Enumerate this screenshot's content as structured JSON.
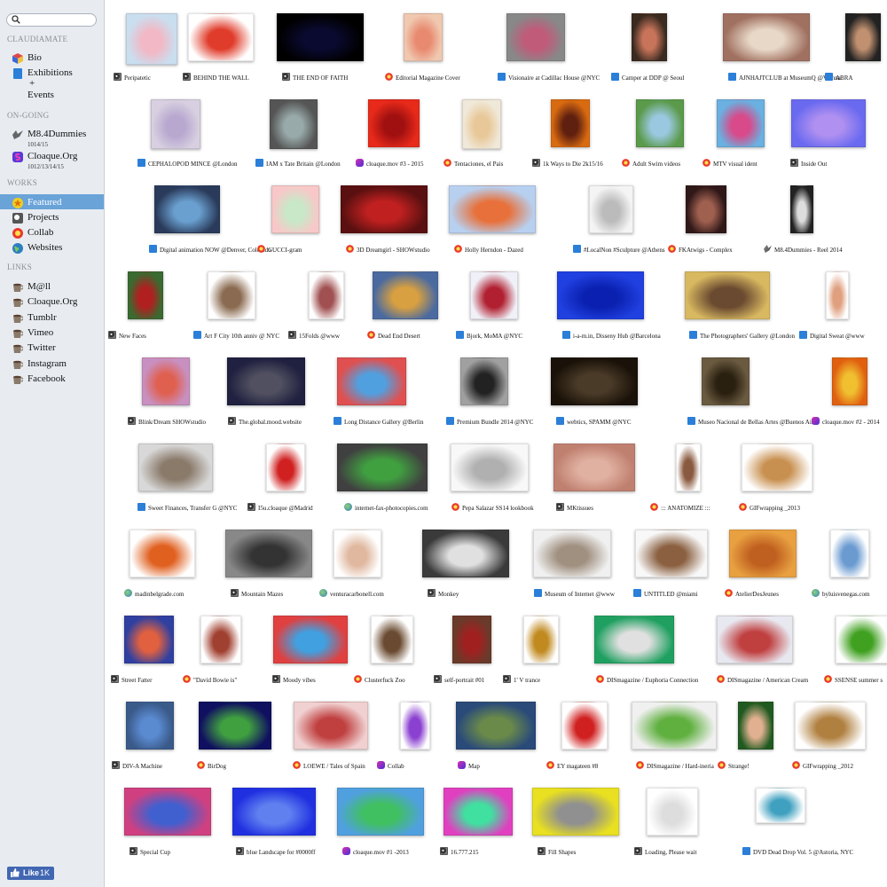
{
  "site": {
    "name": "CLAUDIAMATE",
    "search_placeholder": ""
  },
  "sidebar": {
    "top_items": [
      {
        "label": "Bio",
        "icon": "cube-icon"
      },
      {
        "label": "Exhibitions",
        "label2": "+",
        "label3": "Events",
        "icon": "document-icon"
      }
    ],
    "ongoing_title": "ON-GOING",
    "ongoing": [
      {
        "label": "M8.4Dummies",
        "sub": "1014/15",
        "icon": "bird-icon"
      },
      {
        "label": "Cloaque.Org",
        "sub": "1012/13/14/15",
        "icon": "cloaque-icon"
      }
    ],
    "works_title": "WORKS",
    "works": [
      {
        "label": "Featured",
        "icon": "star-icon",
        "active": true
      },
      {
        "label": "Projects",
        "icon": "work-icon"
      },
      {
        "label": "Collab",
        "icon": "collab-icon"
      },
      {
        "label": "Websites",
        "icon": "globe-icon"
      }
    ],
    "links_title": "LINKS",
    "links": [
      {
        "label": "M@ll",
        "icon": "cup-icon"
      },
      {
        "label": "Cloaque.Org",
        "icon": "cup-icon"
      },
      {
        "label": "Tumblr",
        "icon": "cup-icon"
      },
      {
        "label": "Vimeo",
        "icon": "cup-icon"
      },
      {
        "label": "Twitter",
        "icon": "cup-icon"
      },
      {
        "label": "Instagram",
        "icon": "cup-icon"
      },
      {
        "label": "Facebook",
        "icon": "cup-icon"
      }
    ],
    "like_label": "Like",
    "like_count": "1K"
  },
  "colors": {
    "sidebar_bg": "#e8ecf1",
    "active_bg": "#6aa3d8",
    "facebook_blue": "#4267b2"
  },
  "grid": {
    "rows": [
      [
        {
          "title": "Peripatetic",
          "icon": "work",
          "colors": [
            "#c9dff0",
            "#f2b8c5"
          ]
        },
        {
          "title": "BEHIND THE WALL",
          "icon": "work",
          "colors": [
            "#fff",
            "#e03c2b"
          ]
        },
        {
          "title": "THE END OF FAITH",
          "icon": "work",
          "colors": [
            "#000",
            "#0a0a30"
          ]
        },
        {
          "title": "Editorial Magazine Cover",
          "icon": "collab",
          "colors": [
            "#f0c8b0",
            "#e88a70"
          ]
        },
        {
          "title": "Visionaire at Cadillac House @NYC",
          "icon": "doc",
          "colors": [
            "#888",
            "#c05b7a"
          ]
        },
        {
          "title": "Camper at DDP @ Seoul",
          "icon": "doc",
          "colors": [
            "#3a2a20",
            "#c8745a"
          ]
        },
        {
          "title": "AJNHAJTCLUB at MuseumQ @Vienna",
          "icon": "doc",
          "colors": [
            "#a07060",
            "#e8d8c8"
          ]
        },
        {
          "title": "ABRA",
          "icon": "doc",
          "colors": [
            "#222",
            "#c09070"
          ]
        }
      ],
      [
        {
          "title": "CEPHALOPOD MINCE @London",
          "icon": "doc",
          "colors": [
            "#d8d0e0",
            "#b8a8d0"
          ]
        },
        {
          "title": "IAM x Tate Britain @London",
          "icon": "doc",
          "colors": [
            "#555",
            "#9aa"
          ]
        },
        {
          "title": "cloaque.mov #3 - 2015",
          "icon": "cloaque",
          "colors": [
            "#e82a1a",
            "#a01010"
          ]
        },
        {
          "title": "Tentaciones, el Pais",
          "icon": "collab",
          "colors": [
            "#f0e8d8",
            "#e8c898"
          ]
        },
        {
          "title": "1k Ways to Die 2k15/16",
          "icon": "work",
          "colors": [
            "#d86a10",
            "#602010"
          ]
        },
        {
          "title": "Adult Swim videos",
          "icon": "collab",
          "colors": [
            "#5a9a4a",
            "#9ac8e0"
          ]
        },
        {
          "title": "MTV visual ident",
          "icon": "collab",
          "colors": [
            "#6ab0e0",
            "#d84a8a"
          ]
        },
        {
          "title": "Inside Out",
          "icon": "work",
          "colors": [
            "#6a6af0",
            "#b090f0"
          ]
        }
      ],
      [
        {
          "title": "Digital animation NOW @Denver, Colorado",
          "icon": "doc",
          "colors": [
            "#2a3a5a",
            "#6aa0d0"
          ]
        },
        {
          "title": "GUCCI-gram",
          "icon": "collab",
          "colors": [
            "#f8c8c8",
            "#c8e8c8"
          ]
        },
        {
          "title": "3D Dreamgirl - SHOWstudio",
          "icon": "collab",
          "colors": [
            "#5a1010",
            "#c02020"
          ]
        },
        {
          "title": "Holly Herndon - Dazed",
          "icon": "collab",
          "colors": [
            "#b8d0f0",
            "#e8703a"
          ]
        },
        {
          "title": "#LocalNon #Sculpture @Athens",
          "icon": "doc",
          "colors": [
            "#f4f4f4",
            "#bbb"
          ]
        },
        {
          "title": "FKAtwigs - Complex",
          "icon": "collab",
          "colors": [
            "#301818",
            "#a06050"
          ]
        },
        {
          "title": "M8.4Dummies - Reel 2014",
          "icon": "bird",
          "colors": [
            "#222",
            "#ddd"
          ]
        }
      ],
      [
        {
          "title": "New Faces",
          "icon": "work",
          "colors": [
            "#3a6a30",
            "#b02020"
          ]
        },
        {
          "title": "Art F City 10th anniv @ NYC",
          "icon": "doc",
          "colors": [
            "#fff",
            "#8a6a50"
          ]
        },
        {
          "title": "15Folds @www",
          "icon": "work",
          "colors": [
            "#fff",
            "#a05050"
          ]
        },
        {
          "title": "Dead End Desert",
          "icon": "collab",
          "colors": [
            "#4a6aa0",
            "#d8a040"
          ]
        },
        {
          "title": "Bjork, MoMA @NYC",
          "icon": "doc",
          "colors": [
            "#f0f0f8",
            "#b02030"
          ]
        },
        {
          "title": "i-a-m.in, Disseny Hub @Barcelona",
          "icon": "doc",
          "colors": [
            "#2040e0",
            "#0a20b0"
          ]
        },
        {
          "title": "The Photographers' Gallery @London",
          "icon": "doc",
          "colors": [
            "#d8b860",
            "#6a4a30"
          ]
        },
        {
          "title": "Digital Sweat @www",
          "icon": "doc",
          "colors": [
            "#fff",
            "#e0a080"
          ]
        }
      ],
      [
        {
          "title": "Blink/Dream SHOWstudio",
          "icon": "work",
          "colors": [
            "#c890c0",
            "#e06050"
          ]
        },
        {
          "title": "The.global.mood.website",
          "icon": "work",
          "colors": [
            "#202040",
            "#505060"
          ]
        },
        {
          "title": "Long Distance Gallery @Berlin",
          "icon": "doc",
          "colors": [
            "#e05050",
            "#50a0e0"
          ]
        },
        {
          "title": "Premium Bundle 2014 @NYC",
          "icon": "doc",
          "colors": [
            "#a0a0a0",
            "#222"
          ]
        },
        {
          "title": "webtics, SPAMM @NYC",
          "icon": "doc",
          "colors": [
            "#1a1208",
            "#4a3a28"
          ]
        },
        {
          "title": "Museo Nacional de Bellas Artes @Buenos Aires",
          "icon": "doc",
          "colors": [
            "#6a5a40",
            "#2a2010"
          ]
        },
        {
          "title": "cloaque.mov #2 - 2014",
          "icon": "cloaque",
          "colors": [
            "#e06010",
            "#f0c030"
          ]
        }
      ],
      [
        {
          "title": "Sweet Finances, Transfer G @NYC",
          "icon": "doc",
          "colors": [
            "#d8d8d8",
            "#8a7a6a"
          ]
        },
        {
          "title": "I5u.cloaque @Madrid",
          "icon": "work",
          "colors": [
            "#fff",
            "#d02020"
          ]
        },
        {
          "title": "internet-fax-photocopies.com",
          "icon": "globe",
          "colors": [
            "#404040",
            "#40a040"
          ]
        },
        {
          "title": "Pepa Salazar SS14 lookbook",
          "icon": "collab",
          "colors": [
            "#f8f8f8",
            "#b0b0b0"
          ]
        },
        {
          "title": "MKtissues",
          "icon": "work",
          "colors": [
            "#c08070",
            "#e0b0a0"
          ]
        },
        {
          "title": "::: ANATOMIZE :::",
          "icon": "collab",
          "colors": [
            "#fff",
            "#8a5a40"
          ]
        },
        {
          "title": "GIFwrapping _2013",
          "icon": "collab",
          "colors": [
            "#fff",
            "#c89050"
          ]
        }
      ],
      [
        {
          "title": "madinbelgrade.com",
          "icon": "globe",
          "colors": [
            "#fff",
            "#e06020"
          ]
        },
        {
          "title": "Mountain Mazes",
          "icon": "work",
          "colors": [
            "#888",
            "#333"
          ]
        },
        {
          "title": "venturacarbonell.com",
          "icon": "globe",
          "colors": [
            "#fff",
            "#e0b8a0"
          ]
        },
        {
          "title": "Monkey",
          "icon": "work",
          "colors": [
            "#3a3a3a",
            "#e0e0e0"
          ]
        },
        {
          "title": "Museum of Internet @www",
          "icon": "doc",
          "colors": [
            "#f0f0f0",
            "#a09080"
          ]
        },
        {
          "title": "UNTITLED @miami",
          "icon": "doc",
          "colors": [
            "#f8f8f8",
            "#8a6040"
          ]
        },
        {
          "title": "AtelierDesJeunes",
          "icon": "collab",
          "colors": [
            "#e8a040",
            "#c06020"
          ]
        },
        {
          "title": "byluisvenegas.com",
          "icon": "globe",
          "colors": [
            "#fff",
            "#6a9ad0"
          ]
        }
      ],
      [
        {
          "title": "Street Fatter",
          "icon": "work",
          "colors": [
            "#3040a0",
            "#e06040"
          ]
        },
        {
          "title": "\"David Bowie is\"",
          "icon": "collab",
          "colors": [
            "#fff",
            "#a04030"
          ]
        },
        {
          "title": "Moody vibes",
          "icon": "work",
          "colors": [
            "#e04040",
            "#40a0e0"
          ]
        },
        {
          "title": "Clusterfuck Zoo",
          "icon": "collab",
          "colors": [
            "#fff",
            "#6a4a30"
          ]
        },
        {
          "title": "self-portrait #01",
          "icon": "work",
          "colors": [
            "#6a3a2a",
            "#a02020"
          ]
        },
        {
          "title": "1' V trance",
          "icon": "work",
          "colors": [
            "#fff",
            "#c08a20"
          ]
        },
        {
          "title": "DISmagazine / Euphoria Connection",
          "icon": "collab",
          "colors": [
            "#20a060",
            "#e0e0e0"
          ]
        },
        {
          "title": "DISmagazine / American Cream",
          "icon": "collab",
          "colors": [
            "#e8e8f0",
            "#c04040"
          ]
        },
        {
          "title": "SSENSE summer s",
          "icon": "collab",
          "colors": [
            "#fff",
            "#40a020"
          ]
        }
      ],
      [
        {
          "title": "DIV-A Machine",
          "icon": "work",
          "colors": [
            "#3a5a8a",
            "#5a8ad0"
          ]
        },
        {
          "title": "BirDog",
          "icon": "collab",
          "colors": [
            "#101060",
            "#40a040"
          ]
        },
        {
          "title": "LOEWE / Tales of Spain",
          "icon": "collab",
          "colors": [
            "#f0d0d0",
            "#c04040"
          ]
        },
        {
          "title": "Collab",
          "icon": "cloaque",
          "colors": [
            "#fff",
            "#8a40d0"
          ]
        },
        {
          "title": "Map",
          "icon": "cloaque",
          "colors": [
            "#2a4a7a",
            "#6a8a4a"
          ]
        },
        {
          "title": "EY magateen #8",
          "icon": "collab",
          "colors": [
            "#fff",
            "#d02020"
          ]
        },
        {
          "title": "DISmagazine / Hard-ineria",
          "icon": "collab",
          "colors": [
            "#f0f0f0",
            "#60b040"
          ]
        },
        {
          "title": "Strange!",
          "icon": "collab",
          "colors": [
            "#205a20",
            "#e0b090"
          ]
        },
        {
          "title": "GIFwrapping _2012",
          "icon": "collab",
          "colors": [
            "#fff",
            "#b08040"
          ]
        }
      ],
      [
        {
          "title": "Special Cup",
          "icon": "work",
          "colors": [
            "#d04080",
            "#4060d0"
          ]
        },
        {
          "title": "blue Landscape for #0000ff",
          "icon": "work",
          "colors": [
            "#2030e0",
            "#6080f0"
          ]
        },
        {
          "title": "cloaque.mov #1 -2013",
          "icon": "cloaque",
          "colors": [
            "#50a0e0",
            "#40c060"
          ]
        },
        {
          "title": "16.777.215",
          "icon": "work",
          "colors": [
            "#e040c0",
            "#40e0a0"
          ]
        },
        {
          "title": "Fill Shapes",
          "icon": "work",
          "colors": [
            "#e8e020",
            "#909090"
          ]
        },
        {
          "title": "Loading, Please wait",
          "icon": "work",
          "colors": [
            "#fff",
            "#ddd"
          ]
        },
        {
          "title": "DVD Dead Drop Vol. 5 @Astoria, NYC",
          "icon": "doc",
          "colors": [
            "#fff",
            "#40a0c0"
          ]
        }
      ]
    ]
  }
}
